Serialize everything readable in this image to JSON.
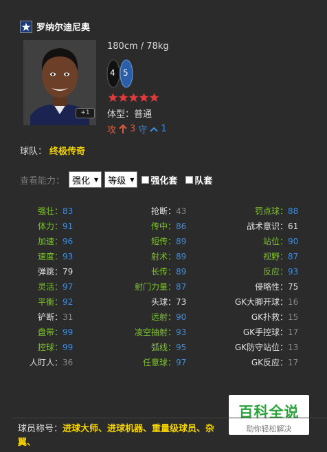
{
  "player": {
    "name": "罗纳尔迪尼奥",
    "height_weight": "180cm / 78kg",
    "badge": "+1",
    "feet": {
      "left": "4",
      "right": "5"
    },
    "stars": 5,
    "body_type": "体型：普通",
    "attack_label": "攻",
    "attack_value": "3",
    "defense_label": "守",
    "defense_value": "1"
  },
  "team": {
    "label": "球队：",
    "name": "终极传奇"
  },
  "filter": {
    "label": "查看能力：",
    "select1": "强化",
    "select2": "等级",
    "checkbox1": "强化套",
    "checkbox2": "队套"
  },
  "stats": {
    "col1": [
      {
        "label": "强壮：",
        "value": "83"
      },
      {
        "label": "体力：",
        "value": "91"
      },
      {
        "label": "加速：",
        "value": "96"
      },
      {
        "label": "速度：",
        "value": "93"
      },
      {
        "label": "弹跳：",
        "value": "79"
      },
      {
        "label": "灵活：",
        "value": "97"
      },
      {
        "label": "平衡：",
        "value": "92"
      },
      {
        "label": "铲断：",
        "value": "31"
      },
      {
        "label": "盘带：",
        "value": "99"
      },
      {
        "label": "控球：",
        "value": "99"
      },
      {
        "label": "人盯人：",
        "value": "36"
      }
    ],
    "col2": [
      {
        "label": "抢断：",
        "value": "43"
      },
      {
        "label": "传中：",
        "value": "86"
      },
      {
        "label": "短传：",
        "value": "89"
      },
      {
        "label": "射术：",
        "value": "89"
      },
      {
        "label": "长传：",
        "value": "89"
      },
      {
        "label": "射门力量：",
        "value": "87"
      },
      {
        "label": "头球：",
        "value": "73"
      },
      {
        "label": "远射：",
        "value": "90"
      },
      {
        "label": "凌空抽射：",
        "value": "93"
      },
      {
        "label": "弧线：",
        "value": "95"
      },
      {
        "label": "任意球：",
        "value": "97"
      }
    ],
    "col3": [
      {
        "label": "罚点球：",
        "value": "88"
      },
      {
        "label": "战术意识：",
        "value": "61"
      },
      {
        "label": "站位：",
        "value": "90"
      },
      {
        "label": "视野：",
        "value": "87"
      },
      {
        "label": "反应：",
        "value": "93"
      },
      {
        "label": "侵略性：",
        "value": "75"
      },
      {
        "label": "GK大脚开球：",
        "value": "16"
      },
      {
        "label": "GK扑救：",
        "value": "15"
      },
      {
        "label": "GK手控球：",
        "value": "17"
      },
      {
        "label": "GK防守站位：",
        "value": "13"
      },
      {
        "label": "GK反应：",
        "value": "17"
      }
    ]
  },
  "nicknames": {
    "label": "球员称号：",
    "values": "进球大师、进球机器、重量级球员、杂",
    "wrap": "翼、"
  },
  "watermark": {
    "title": "百科全说",
    "subtitle": "助你轻松解决"
  },
  "colors": {
    "green": "#7ec52a",
    "blue": "#3d8ee0",
    "yellow": "#f5d300",
    "red_star": "#e03a3a",
    "attack": "#e05a3c"
  }
}
